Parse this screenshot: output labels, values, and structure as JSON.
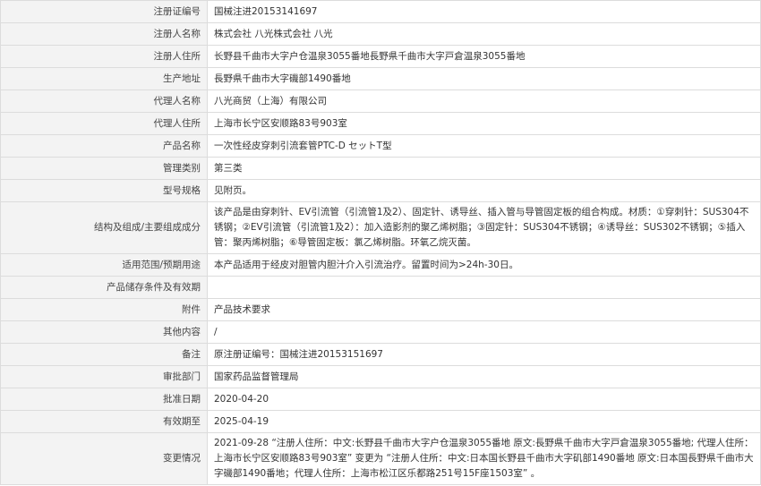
{
  "rows": [
    {
      "label": "注册证编号",
      "value": "国械注进20153141697"
    },
    {
      "label": "注册人名称",
      "value": "株式会社 八光株式会社 八光"
    },
    {
      "label": "注册人住所",
      "value": "长野县千曲市大字户仓温泉3055番地長野県千曲市大字戸倉温泉3055番地"
    },
    {
      "label": "生产地址",
      "value": "長野県千曲市大字磯部1490番地"
    },
    {
      "label": "代理人名称",
      "value": "八光商贸（上海）有限公司"
    },
    {
      "label": "代理人住所",
      "value": "上海市长宁区安顺路83号903室"
    },
    {
      "label": "产品名称",
      "value": "一次性经皮穿刺引流套管PTC-D セットT型"
    },
    {
      "label": "管理类别",
      "value": "第三类"
    },
    {
      "label": "型号规格",
      "value": "见附页。"
    },
    {
      "label": "结构及组成/主要组成成分",
      "value": "该产品是由穿刺针、EV引流管（引流管1及2）、固定针、诱导丝、插入管与导管固定板的组合构成。材质：①穿刺针：SUS304不锈钢；②EV引流管（引流管1及2）：加入造影剂的聚乙烯树脂；③固定针：SUS304不锈钢；④诱导丝：SUS302不锈钢；⑤插入管：聚丙烯树脂；⑥导管固定板：氯乙烯树脂。环氧乙烷灭菌。"
    },
    {
      "label": "适用范围/预期用途",
      "value": "本产品适用于经皮对胆管内胆汁介入引流治疗。留置时间为>24h-30日。"
    },
    {
      "label": "产品储存条件及有效期",
      "value": ""
    },
    {
      "label": "附件",
      "value": "产品技术要求"
    },
    {
      "label": "其他内容",
      "value": "/"
    },
    {
      "label": "备注",
      "value": "原注册证编号：国械注进20153151697"
    },
    {
      "label": "审批部门",
      "value": "国家药品监督管理局"
    },
    {
      "label": "批准日期",
      "value": "2020-04-20"
    },
    {
      "label": "有效期至",
      "value": "2025-04-19"
    },
    {
      "label": "变更情况",
      "value": "2021-09-28 “注册人住所：中文:长野县千曲市大字户仓温泉3055番地 原文:長野県千曲市大字戸倉温泉3055番地; 代理人住所：上海市长宁区安顺路83号903室” 变更为 “注册人住所：中文:日本国长野县千曲市大字矶部1490番地 原文:日本国長野県千曲市大字磯部1490番地；代理人住所：上海市松江区乐都路251号15F座1503室” 。"
    }
  ]
}
